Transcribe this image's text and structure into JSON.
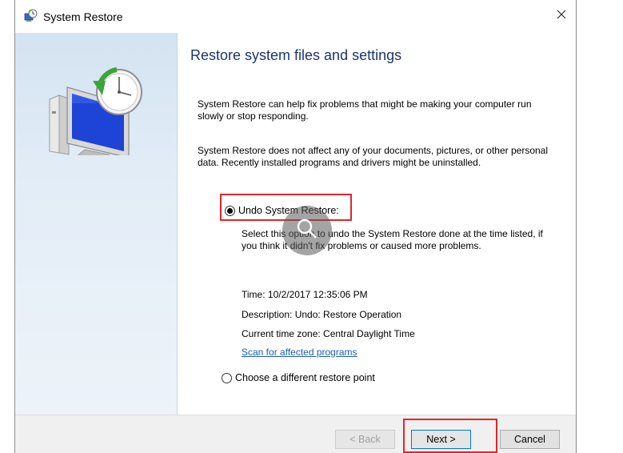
{
  "window": {
    "title": "System Restore",
    "close_glyph": "✕"
  },
  "heading": "Restore system files and settings",
  "intro": {
    "para1": "System Restore can help fix problems that might be making your computer run slowly or stop responding.",
    "para2": "System Restore does not affect any of your documents, pictures, or other personal data. Recently installed programs and drivers might be uninstalled."
  },
  "options": {
    "undo": {
      "label": "Undo System Restore:",
      "checked": true,
      "description": "Select this option to undo the System Restore done at the time listed, if you think it didn't fix problems or caused more problems.",
      "time": "Time: 10/2/2017 12:35:06 PM",
      "desc_line": "Description: Undo: Restore Operation",
      "timezone": "Current time zone: Central Daylight Time",
      "scan_link": "Scan for affected programs"
    },
    "other": {
      "label": "Choose a different restore point",
      "checked": false
    }
  },
  "footer": {
    "back_label": "< Back",
    "next_label": "Next >",
    "cancel_label": "Cancel"
  },
  "icons": {
    "title": "system-restore-icon",
    "sidebar": "computer-restore-icon",
    "overlay": "magnifier-icon"
  },
  "colors": {
    "heading": "#1a3572",
    "link": "#1a5fb4",
    "highlight": "#e0262b",
    "sidebar": "#dce8f4"
  }
}
